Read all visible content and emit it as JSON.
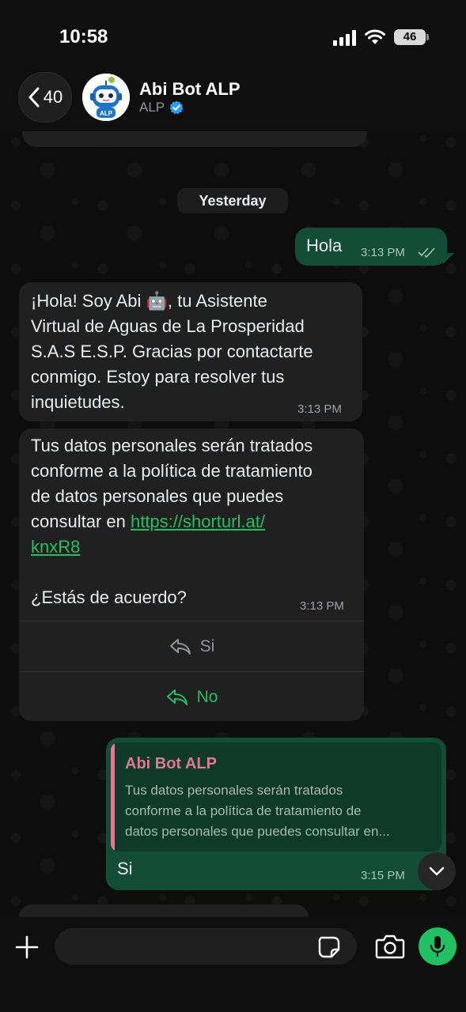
{
  "status_bar": {
    "time": "10:58",
    "battery": "46"
  },
  "header": {
    "back_count": "40",
    "contact_name": "Abi Bot ALP",
    "contact_subtitle": "ALP",
    "avatar_label": "ALP"
  },
  "date_chip": "Yesterday",
  "messages": [
    {
      "direction": "out",
      "text": "Hola",
      "time": "3:13 PM",
      "status": "read"
    },
    {
      "direction": "in",
      "text": "¡Hola! Soy Abi 🤖, tu Asistente\nVirtual de Aguas de La Prosperidad\nS.A.S E.S.P. Gracias por contactarte\nconmigo. Estoy para resolver tus\ninquietudes.",
      "time": "3:13 PM"
    },
    {
      "direction": "in",
      "text_before_link": "Tus datos personales serán tratados\nconforme a la política de tratamiento\nde datos personales que puedes\nconsultar en ",
      "link": "https://shorturl.at/\nknxR8",
      "text_after_link": "\n\n¿Estás de acuerdo?",
      "time": "3:13 PM",
      "quick_replies": [
        {
          "label": "Si",
          "state": "used"
        },
        {
          "label": "No",
          "state": "active"
        }
      ]
    },
    {
      "direction": "out",
      "quote": {
        "name": "Abi Bot ALP",
        "text": "Tus datos personales serán tratados\nconforme a la política de tratamiento de\ndatos personales que puedes consultar en..."
      },
      "text": "Si",
      "time": "3:15 PM"
    }
  ],
  "composer": {
    "placeholder": ""
  },
  "colors": {
    "accent": "#21c063",
    "outgoing_bubble": "#144d37",
    "incoming_bubble": "#202020",
    "quote_name": "#e07a92"
  }
}
